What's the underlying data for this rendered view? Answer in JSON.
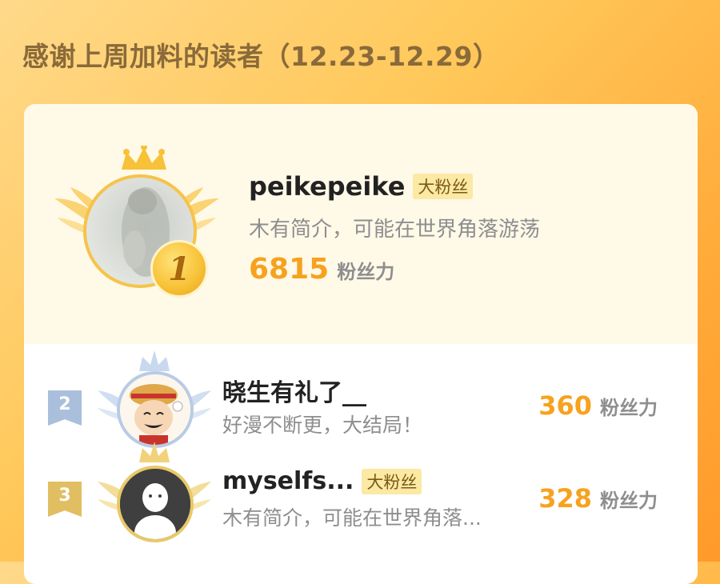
{
  "header": {
    "title": "感谢上周加料的读者（12.23-12.29）"
  },
  "colors": {
    "accent_orange": "#f7a21e",
    "gold": "#f6c34a",
    "silver_blue": "#a9bfdb",
    "bronze": "#e1be62",
    "tag_bg": "#fbe9a4"
  },
  "leaderboard": {
    "unit_label": "粉丝力",
    "entries": [
      {
        "rank": "1",
        "username": "peikepeike",
        "tag": "大粉丝",
        "bio": "木有简介，可能在世界角落游荡",
        "score": "6815",
        "avatar_icon": "cat-photo-avatar"
      },
      {
        "rank": "2",
        "username": "晓生有礼了__",
        "tag": "",
        "bio": "好漫不断更，大结局！",
        "score": "360",
        "avatar_icon": "cartoon-boy-avatar"
      },
      {
        "rank": "3",
        "username": "myselfs...",
        "tag": "大粉丝",
        "bio": "木有简介，可能在世界角落...",
        "score": "328",
        "avatar_icon": "default-user-avatar"
      }
    ]
  }
}
